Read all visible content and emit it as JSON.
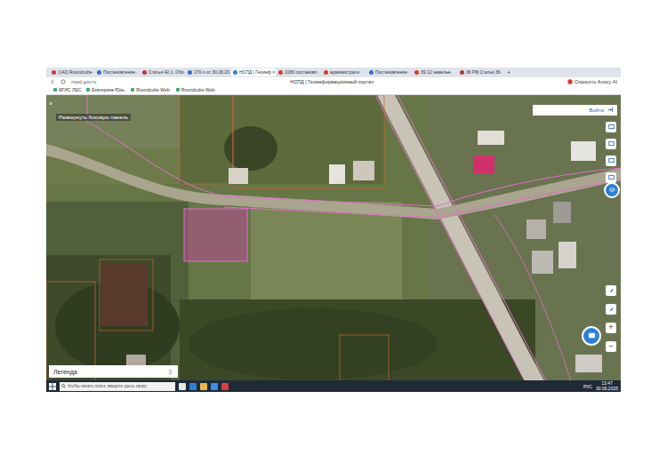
{
  "browser": {
    "tabs": [
      {
        "label": "(142) Roundcube ·",
        "selected": false,
        "color": "#c33d3d"
      },
      {
        "label": "Постановление ·",
        "selected": false,
        "color": "#3a6fc4"
      },
      {
        "label": "Статья 42.1. Обо·",
        "selected": false,
        "color": "#b23a3a"
      },
      {
        "label": "170-п от 30.06.20·",
        "selected": false,
        "color": "#3a6fc4"
      },
      {
        "label": "НСПД | Геоинф ×",
        "selected": true,
        "color": "#2d7fd6"
      },
      {
        "label": "1066 постановл·",
        "selected": false,
        "color": "#d0402f"
      },
      {
        "label": "администрати·",
        "selected": false,
        "color": "#d0402f"
      },
      {
        "label": "Постановление ·",
        "selected": false,
        "color": "#3a6fc4"
      },
      {
        "label": "39.12 земельн·",
        "selected": false,
        "color": "#d0402f"
      },
      {
        "label": "36 РФ Статья 36·",
        "selected": false,
        "color": "#b23a3a"
      }
    ],
    "new_tab": "+",
    "address": "nspd.gov.ru",
    "page_title": "НСПД | Геоинформационный портал",
    "assistant": "Спросить Алису AI",
    "bookmarks": [
      "ФГИС ЛЕС",
      "Екатерина Юрь·",
      "Roundcube Web·",
      "Roundcube Web·"
    ]
  },
  "map": {
    "expand": "»",
    "side_panel_button": "Развернуть боковую панель",
    "login": "Войти",
    "legend": "Легенда",
    "zoom_in": "+",
    "zoom_out": "−"
  },
  "taskbar": {
    "search_placeholder": "Чтобы начать поиск, введите здесь запро",
    "language": "РУС",
    "time": "13:47",
    "date": "30.06.2025"
  }
}
